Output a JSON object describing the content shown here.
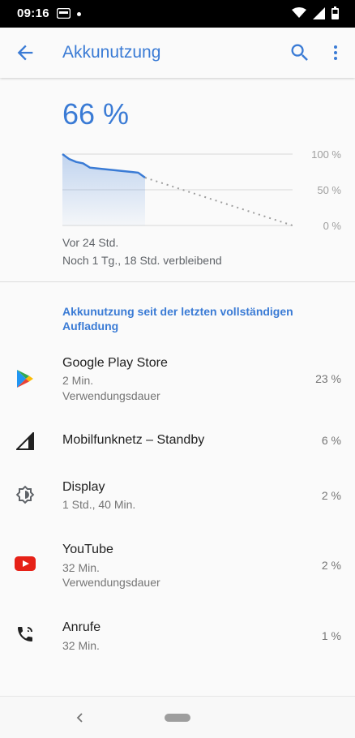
{
  "status_bar": {
    "time": "09:16",
    "notification_icon": "notification-card-icon",
    "wifi_icon": "wifi-icon",
    "signal_icon": "signal-icon",
    "battery_icon": "battery-icon"
  },
  "app_bar": {
    "title": "Akkunutzung",
    "back_icon": "arrow-back-icon",
    "search_icon": "search-icon",
    "more_icon": "more-vert-icon"
  },
  "battery": {
    "percent_text": "66 %",
    "level_percent": 66
  },
  "chart_data": {
    "type": "area",
    "y_ticks": [
      "100 %",
      "50 %",
      "0 %"
    ],
    "ylim": [
      0,
      100
    ],
    "grid": true,
    "series": [
      {
        "x": [
          0,
          1,
          2,
          3,
          4,
          5,
          6,
          7,
          8,
          9,
          10,
          11,
          12
        ],
        "values": [
          100,
          93,
          89,
          87,
          81,
          80,
          79,
          78,
          77,
          76,
          75,
          74,
          67
        ]
      }
    ],
    "projection": {
      "from_percent": 67,
      "to_percent": 0
    },
    "accent_color": "#3a7bd5",
    "projection_color": "#9e9e9e"
  },
  "chart_caption": {
    "time_ago": "Vor 24 Std.",
    "remaining": "Noch 1 Tg., 18 Std. verbleibend"
  },
  "section_heading": "Akkunutzung seit der letzten vollständigen Aufladung",
  "apps": [
    {
      "name": "Google Play Store",
      "line1": "2 Min.",
      "line2": "Verwendungsdauer",
      "percent": "23 %",
      "icon": "google-play-store-icon"
    },
    {
      "name": "Mobilfunknetz – Standby",
      "line1": "",
      "line2": "",
      "percent": "6 %",
      "icon": "cell-signal-icon"
    },
    {
      "name": "Display",
      "line1": "1 Std., 40 Min.",
      "line2": "",
      "percent": "2 %",
      "icon": "display-brightness-icon"
    },
    {
      "name": "YouTube",
      "line1": "32 Min.",
      "line2": "Verwendungsdauer",
      "percent": "2 %",
      "icon": "youtube-icon"
    },
    {
      "name": "Anrufe",
      "line1": "32 Min.",
      "line2": "",
      "percent": "1 %",
      "icon": "phone-calls-icon"
    }
  ],
  "nav_bar": {
    "back_icon": "nav-back-icon",
    "home_icon": "nav-home-pill-icon"
  }
}
